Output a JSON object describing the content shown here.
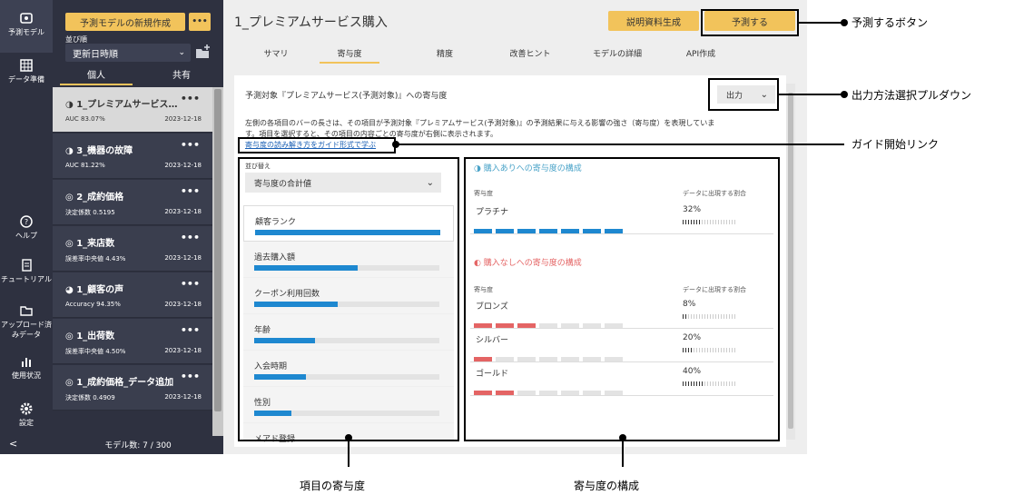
{
  "rail": {
    "items": [
      {
        "label": "予測モデル",
        "icon": "predict-model-icon"
      },
      {
        "label": "データ準備",
        "icon": "data-prep-icon"
      },
      {
        "label": "ヘルプ",
        "icon": "help-icon"
      },
      {
        "label": "チュートリアル",
        "icon": "tutorial-icon"
      },
      {
        "label": "アップロード済みデータ",
        "icon": "upload-folder-icon"
      },
      {
        "label": "使用状況",
        "icon": "usage-icon"
      },
      {
        "label": "設定",
        "icon": "settings-icon"
      }
    ],
    "collapse": "<"
  },
  "listpanel": {
    "new_model": "予測モデルの新規作成",
    "more": "•••",
    "sort_label": "並び順",
    "sort_value": "更新日時順",
    "tabs": [
      "個人",
      "共有"
    ],
    "count": "モデル数: 7 / 300"
  },
  "models": [
    {
      "name": "1_プレミアムサービス…",
      "metric": "AUC 83.07%",
      "date": "2023-12-18"
    },
    {
      "name": "3_機器の故障",
      "metric": "AUC 81.22%",
      "date": "2023-12-18"
    },
    {
      "name": "2_成約価格",
      "metric": "決定係数 0.5195",
      "date": "2023-12-18"
    },
    {
      "name": "1_来店数",
      "metric": "誤差率中央値 4.43%",
      "date": "2023-12-18"
    },
    {
      "name": "1_顧客の声",
      "metric": "Accuracy 94.35%",
      "date": "2023-12-18"
    },
    {
      "name": "1_出荷数",
      "metric": "誤差率中央値 4.50%",
      "date": "2023-12-18"
    },
    {
      "name": "1_成約価格_データ追加",
      "metric": "決定係数 0.4909",
      "date": "2023-12-18"
    }
  ],
  "main": {
    "title": "1_プレミアムサービス購入",
    "doc_button": "説明資料生成",
    "predict_button": "予測する",
    "tabs": [
      "サマリ",
      "寄与度",
      "精度",
      "改善ヒント",
      "モデルの詳細",
      "API作成"
    ],
    "heading": "予測対象『プレミアムサービス(予測対象)』への寄与度",
    "output": "出力",
    "desc1": "左側の各項目のバーの長さは、その項目が予測対象『プレミアムサービス(予測対象)』の予測結果に与える影響の強さ（寄与度）を表現していま",
    "desc2": "す。項目を選択すると、その項目の内容ごとの寄与度が右側に表示されます。",
    "guide_link": "寄与度の読み解き方をガイド形式で学ぶ",
    "sort_label": "並び替え",
    "sort_value": "寄与度の合計値"
  },
  "features": [
    {
      "name": "顧客ランク",
      "value": 1.0
    },
    {
      "name": "過去購入額",
      "value": 0.56
    },
    {
      "name": "クーポン利用回数",
      "value": 0.45
    },
    {
      "name": "年齢",
      "value": 0.33
    },
    {
      "name": "入会時期",
      "value": 0.28
    },
    {
      "name": "性別",
      "value": 0.2
    },
    {
      "name": "メアド登録",
      "value": 0.0
    }
  ],
  "composition": {
    "yes_title": "購入ありへの寄与度の構成",
    "no_title": "購入なしへの寄与度の構成",
    "col_contrib": "寄与度",
    "col_ratio": "データに出現する割合",
    "yes_rows": [
      {
        "name": "プラチナ",
        "segments": 7,
        "ratio": "32%"
      }
    ],
    "no_rows": [
      {
        "name": "ブロンズ",
        "segments": 3,
        "ratio": "8%"
      },
      {
        "name": "シルバー",
        "segments": 1,
        "ratio": "20%"
      },
      {
        "name": "ゴールド",
        "segments": 2,
        "ratio": "40%"
      }
    ]
  },
  "annotations": {
    "predict_button": "予測するボタン",
    "output_pulldown": "出力方法選択プルダウン",
    "guide_link": "ガイド開始リンク",
    "feature_contrib": "項目の寄与度",
    "contrib_composition": "寄与度の構成"
  },
  "colors": {
    "accent": "#f2c35b",
    "blue": "#1e88d0",
    "red": "#e46464",
    "dark": "#2e3140"
  }
}
